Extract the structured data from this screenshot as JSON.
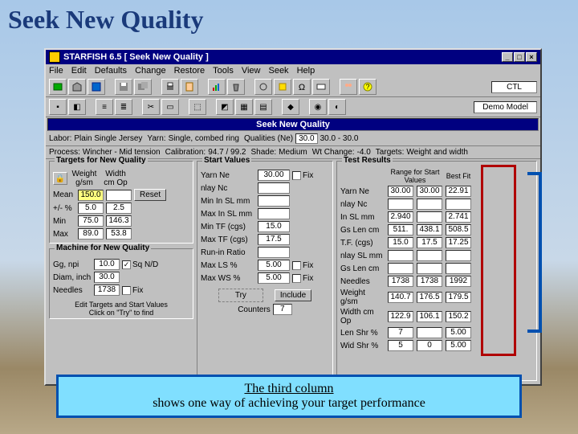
{
  "page": {
    "title": "Seek New Quality"
  },
  "window": {
    "title": "STARFISH 6.5   [ Seek New Quality ]"
  },
  "menu": [
    "File",
    "Edit",
    "Defaults",
    "Change",
    "Restore",
    "Tools",
    "View",
    "Seek",
    "Help"
  ],
  "toolbar2_right": "Demo Model",
  "ctl": "CTL",
  "banner": "Seek New Quality",
  "info": {
    "labor": "Plain Single Jersey",
    "process": "Wincher - Mid tension",
    "yarn": "Single, combed ring",
    "calibration": "94.7 / 99.2",
    "qualities_label": "Qualities (Ne)",
    "qualities_field": "30.0",
    "qualities_range": "30.0 - 30.0",
    "shade": "Medium",
    "wtchange": "-4.0",
    "targets": "Weight and width"
  },
  "targets_group": {
    "legend": "Targets for New Quality",
    "col_weight": "Weight g/sm",
    "col_width": "Width cm Op",
    "mean": "Mean",
    "mean_weight": "150.0",
    "reset": "Reset",
    "pct": "+/- %",
    "pct_weight": "5.0",
    "pct_width": "2.5",
    "min": "Min",
    "min_weight": "75.0",
    "min_width": "146.3",
    "max": "Max",
    "max_weight": "89.0",
    "max_width": "53.8"
  },
  "machine_group": {
    "legend": "Machine for New Quality",
    "gg": "Gg, npi",
    "gg1": "10.0",
    "gg_chk": "Sq N/D",
    "diam": "Diam, inch",
    "diam_val": "30.0",
    "ndls": "Needles",
    "ndls_val": "1738",
    "ndls_fix": "Fix",
    "hint1": "Edit Targets and Start Values",
    "hint2": "Click on \"Try\" to find"
  },
  "start_group": {
    "legend": "Start Values",
    "rows": [
      {
        "l": "Yarn Ne",
        "v": "30.00",
        "fix": true
      },
      {
        "l": "nlay Nc",
        "v": ""
      },
      {
        "l": "Min In SL mm",
        "v": ""
      },
      {
        "l": "Max In SL mm",
        "v": ""
      },
      {
        "l": "Min TF (cgs)",
        "v": "15.0"
      },
      {
        "l": "Max TF (cgs)",
        "v": "17.5"
      },
      {
        "l": "Run-in Ratio",
        "v": ""
      },
      {
        "l": "Max LS %",
        "v": "5.00",
        "fix": true
      },
      {
        "l": "Max WS %",
        "v": "5.00",
        "fix": true
      }
    ],
    "try": "Try",
    "include": "Include",
    "counters": "Counters",
    "counters_val": "7"
  },
  "results_group": {
    "legend": "Test Results",
    "hd1": "Range for Start Values",
    "hd2": "Best Fit",
    "rows": [
      {
        "l": "Yarn Ne",
        "a": "30.00",
        "b": "30.00",
        "c": "22.91"
      },
      {
        "l": "nlay Nc",
        "a": "",
        "b": "",
        "c": ""
      },
      {
        "l": "In SL mm",
        "a": "2.940",
        "b": "",
        "c": "2.741"
      },
      {
        "l": "Gs Len cm",
        "a": "511.",
        "b": "438.1",
        "c": "508.5"
      },
      {
        "l": "T.F. (cgs)",
        "a": "15.0",
        "b": "17.5",
        "c": "17.25"
      },
      {
        "l": "nlay SL mm",
        "a": "",
        "b": "",
        "c": ""
      },
      {
        "l": "Gs Len cm",
        "a": "",
        "b": "",
        "c": ""
      },
      {
        "l": "Needles",
        "a": "1738",
        "b": "1738",
        "c": "1992"
      },
      {
        "l": "Weight g/sm",
        "a": "140.7",
        "b": "176.5",
        "c": "179.5"
      },
      {
        "l": "Width cm Op",
        "a": "122.9",
        "b": "106.1",
        "c": "150.2"
      },
      {
        "l": "Len Shr %",
        "a": "7",
        "b": "",
        "c": "5.00"
      },
      {
        "l": "Wid Shr %",
        "a": "5",
        "b": "0",
        "c": "5.00"
      }
    ]
  },
  "caption": {
    "line1": "The third column",
    "line2": "shows one way of achieving your target performance"
  }
}
